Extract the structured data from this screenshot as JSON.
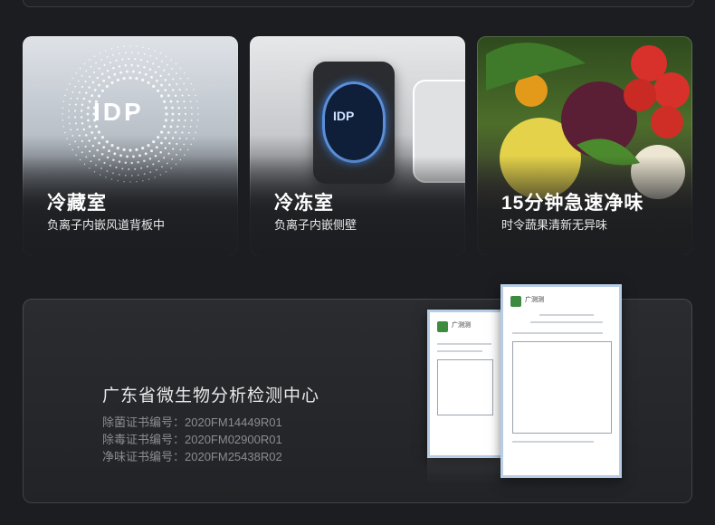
{
  "cards": [
    {
      "title": "冷藏室",
      "subtitle": "负离子内嵌风道背板中",
      "logo_text": "IDP"
    },
    {
      "title": "冷冻室",
      "subtitle": "负离子内嵌侧壁",
      "device_text": "IDP"
    },
    {
      "title": "15分钟急速净味",
      "subtitle": "时令蔬果清新无异味"
    }
  ],
  "certification": {
    "title": "广东省微生物分析检测中心",
    "lines": [
      "除菌证书编号：2020FM14449R01",
      "除毒证书编号：2020FM02900R01",
      "净味证书编号：2020FM25438R02"
    ],
    "doc_logo_text": "广测测"
  },
  "colors": {
    "background": "#1c1d20",
    "device_glow": "#5b8fd8"
  },
  "icons": [
    "idp-logo-icon",
    "ionizer-device-icon",
    "produce-image",
    "certificate-document-icon"
  ]
}
